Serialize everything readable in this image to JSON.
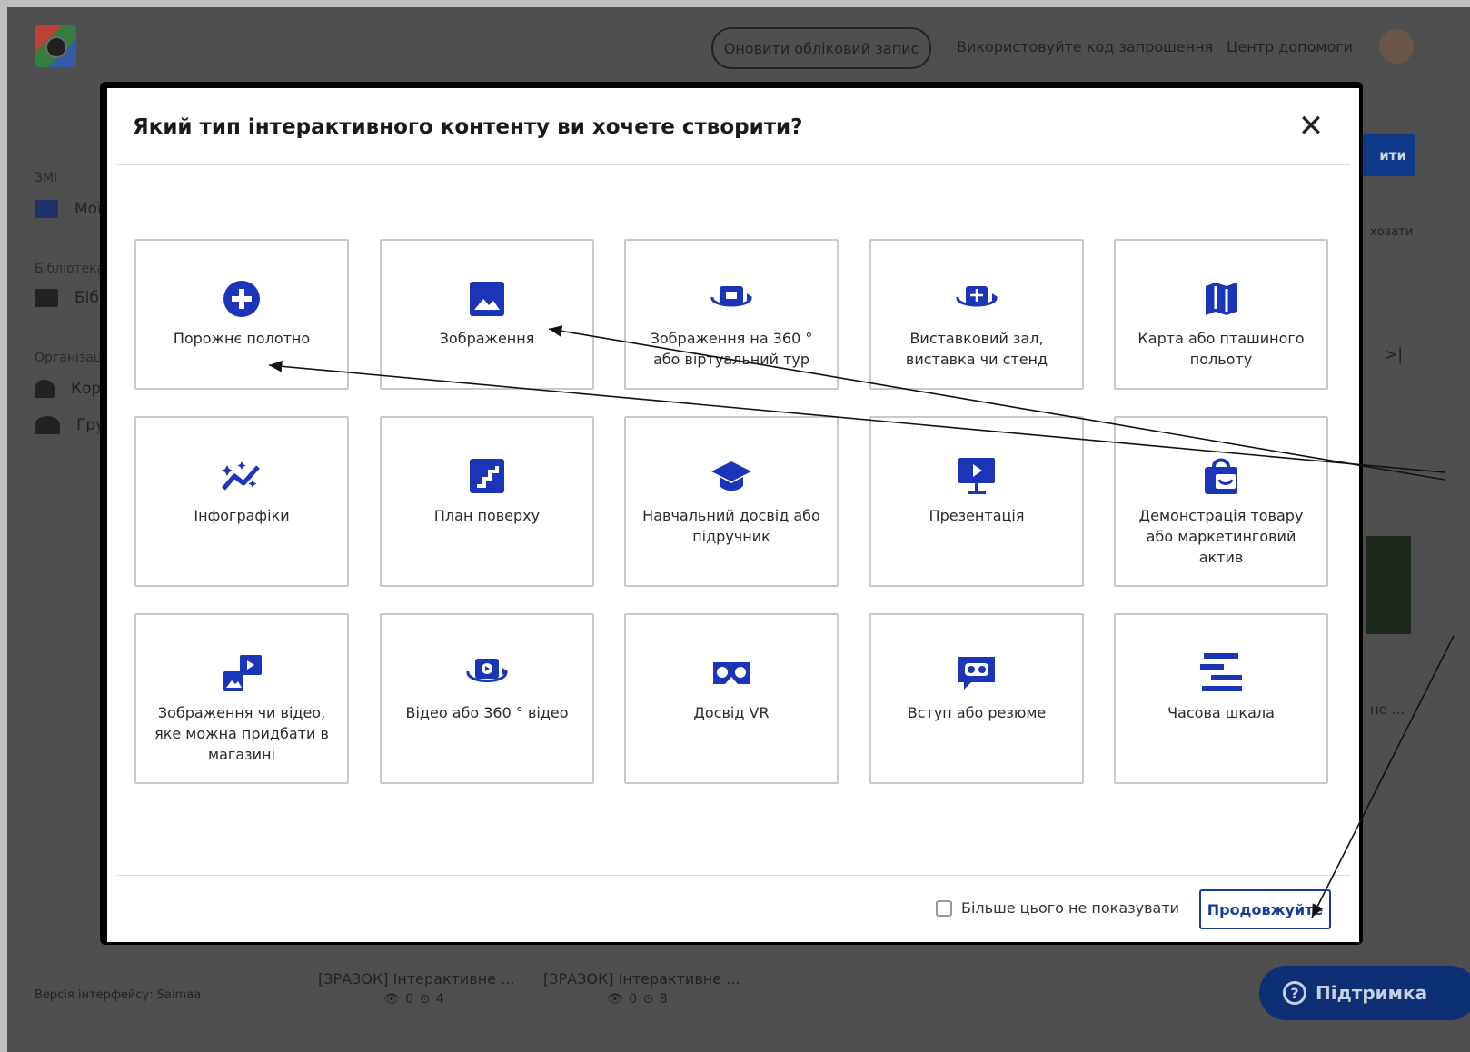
{
  "topbar": {
    "upgrade_label": "Оновити обліковий запис",
    "invite_link": "Використовуйте код запрошення",
    "help_link": "Центр допомоги"
  },
  "sidebar": {
    "media_label": "ЗМІ",
    "media_item": "Мої",
    "library_label": "Бібліотека",
    "library_item": "Біб",
    "org_label": "Організац",
    "org_item1": "Кор",
    "org_item2": "Гру",
    "version": "Версія інтерфейсу: Saimaa"
  },
  "background": {
    "blue_btn": "ити",
    "hide_text": "ховати",
    "chevron_text": ">|",
    "ne_text": "не ...",
    "sample1_title": "[ЗРАЗОК] Інтерактивне ...",
    "sample1_stats": "👁 0  ⊙ 4",
    "sample2_title": "[ЗРАЗОК] Інтерактивне ...",
    "sample2_stats": "👁 0  ⊙ 8",
    "support_label": "Підтримка",
    "support_q": "?"
  },
  "modal": {
    "title": "Який тип інтерактивного контенту ви хочете створити?",
    "close_label": "✕",
    "dont_show_label": "Більше цього не показувати",
    "continue_label": "Продовжуйте",
    "accent": "#1a35b8",
    "cards": [
      {
        "label": "Порожнє полотно",
        "icon": "plus-circle-icon"
      },
      {
        "label": "Зображення",
        "icon": "image-icon"
      },
      {
        "label": "Зображення на 360 ° або віртуальний тур",
        "icon": "360-image-icon"
      },
      {
        "label": "Виставковий зал, виставка чи стенд",
        "icon": "exhibit-icon"
      },
      {
        "label": "Карта або пташиного польоту",
        "icon": "map-icon"
      },
      {
        "label": "Інфографіки",
        "icon": "infographic-icon"
      },
      {
        "label": "План поверху",
        "icon": "floor-plan-icon"
      },
      {
        "label": "Навчальний досвід або підручник",
        "icon": "graduation-cap-icon"
      },
      {
        "label": "Презентація",
        "icon": "presentation-icon"
      },
      {
        "label": "Демонстрація товару або маркетинговий актив",
        "icon": "shopping-bag-icon"
      },
      {
        "label": "Зображення чи відео, яке можна придбати в магазині",
        "icon": "shoppable-media-icon"
      },
      {
        "label": "Відео або 360 ° відео",
        "icon": "360-video-icon"
      },
      {
        "label": "Досвід VR",
        "icon": "vr-goggles-icon"
      },
      {
        "label": "Вступ або резюме",
        "icon": "intro-icon"
      },
      {
        "label": "Часова шкала",
        "icon": "timeline-icon"
      }
    ]
  }
}
